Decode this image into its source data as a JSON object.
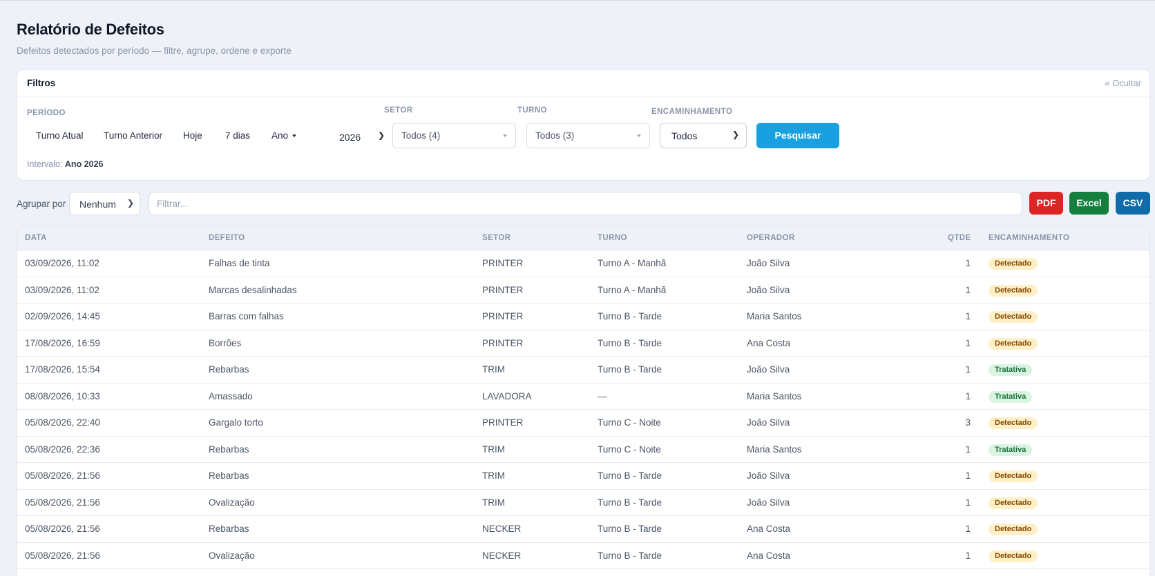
{
  "header": {
    "title": "Relatório de Defeitos",
    "subtitle": "Defeitos detectados por período — filtre, agrupe, ordene e exporte"
  },
  "filters": {
    "title": "Filtros",
    "hide_label": "« Ocultar",
    "period_label": "PERÍODO",
    "period_options": [
      "Turno Atual",
      "Turno Anterior",
      "Hoje",
      "7 dias",
      "Ano"
    ],
    "year": "2026",
    "setor_label": "SETOR",
    "setor_value": "Todos (4)",
    "turno_label": "TURNO",
    "turno_value": "Todos (3)",
    "encaminhamento_label": "ENCAMINHAMENTO",
    "encaminhamento_value": "Todos",
    "search_button": "Pesquisar",
    "interval_label": "Intervalo:",
    "interval_value": "Ano 2026"
  },
  "toolbar": {
    "group_label": "Agrupar por",
    "group_value": "Nenhum",
    "filter_placeholder": "Filtrar...",
    "pdf": "PDF",
    "excel": "Excel",
    "csv": "CSV"
  },
  "table": {
    "columns": [
      "DATA",
      "DEFEITO",
      "SETOR",
      "TURNO",
      "OPERADOR",
      "QTDE",
      "ENCAMINHAMENTO"
    ],
    "rows": [
      {
        "data": "03/09/2026, 11:02",
        "defeito": "Falhas de tinta",
        "setor": "PRINTER",
        "turno": "Turno A - Manhã",
        "operador": "João Silva",
        "qtde": "1",
        "status": "Detectado"
      },
      {
        "data": "03/09/2026, 11:02",
        "defeito": "Marcas desalinhadas",
        "setor": "PRINTER",
        "turno": "Turno A - Manhã",
        "operador": "João Silva",
        "qtde": "1",
        "status": "Detectado"
      },
      {
        "data": "02/09/2026, 14:45",
        "defeito": "Barras com falhas",
        "setor": "PRINTER",
        "turno": "Turno B - Tarde",
        "operador": "Maria Santos",
        "qtde": "1",
        "status": "Detectado"
      },
      {
        "data": "17/08/2026, 16:59",
        "defeito": "Borrões",
        "setor": "PRINTER",
        "turno": "Turno B - Tarde",
        "operador": "Ana Costa",
        "qtde": "1",
        "status": "Detectado"
      },
      {
        "data": "17/08/2026, 15:54",
        "defeito": "Rebarbas",
        "setor": "TRIM",
        "turno": "Turno B - Tarde",
        "operador": "João Silva",
        "qtde": "1",
        "status": "Tratativa"
      },
      {
        "data": "08/08/2026, 10:33",
        "defeito": "Amassado",
        "setor": "LAVADORA",
        "turno": "—",
        "operador": "Maria Santos",
        "qtde": "1",
        "status": "Tratativa"
      },
      {
        "data": "05/08/2026, 22:40",
        "defeito": "Gargalo torto",
        "setor": "PRINTER",
        "turno": "Turno C - Noite",
        "operador": "João Silva",
        "qtde": "3",
        "status": "Detectado"
      },
      {
        "data": "05/08/2026, 22:36",
        "defeito": "Rebarbas",
        "setor": "TRIM",
        "turno": "Turno C - Noite",
        "operador": "Maria Santos",
        "qtde": "1",
        "status": "Tratativa"
      },
      {
        "data": "05/08/2026, 21:56",
        "defeito": "Rebarbas",
        "setor": "TRIM",
        "turno": "Turno B - Tarde",
        "operador": "João Silva",
        "qtde": "1",
        "status": "Detectado"
      },
      {
        "data": "05/08/2026, 21:56",
        "defeito": "Ovalização",
        "setor": "TRIM",
        "turno": "Turno B - Tarde",
        "operador": "João Silva",
        "qtde": "1",
        "status": "Detectado"
      },
      {
        "data": "05/08/2026, 21:56",
        "defeito": "Rebarbas",
        "setor": "NECKER",
        "turno": "Turno B - Tarde",
        "operador": "Ana Costa",
        "qtde": "1",
        "status": "Detectado"
      },
      {
        "data": "05/08/2026, 21:56",
        "defeito": "Ovalização",
        "setor": "NECKER",
        "turno": "Turno B - Tarde",
        "operador": "Ana Costa",
        "qtde": "1",
        "status": "Detectado"
      }
    ]
  },
  "colors": {
    "accent": "#18a0e0",
    "pdf": "#dc2626",
    "excel": "#15803d",
    "csv": "#0f6ca8",
    "detectado_bg": "#fdf0c6",
    "tratativa_bg": "#d9f5e1"
  }
}
